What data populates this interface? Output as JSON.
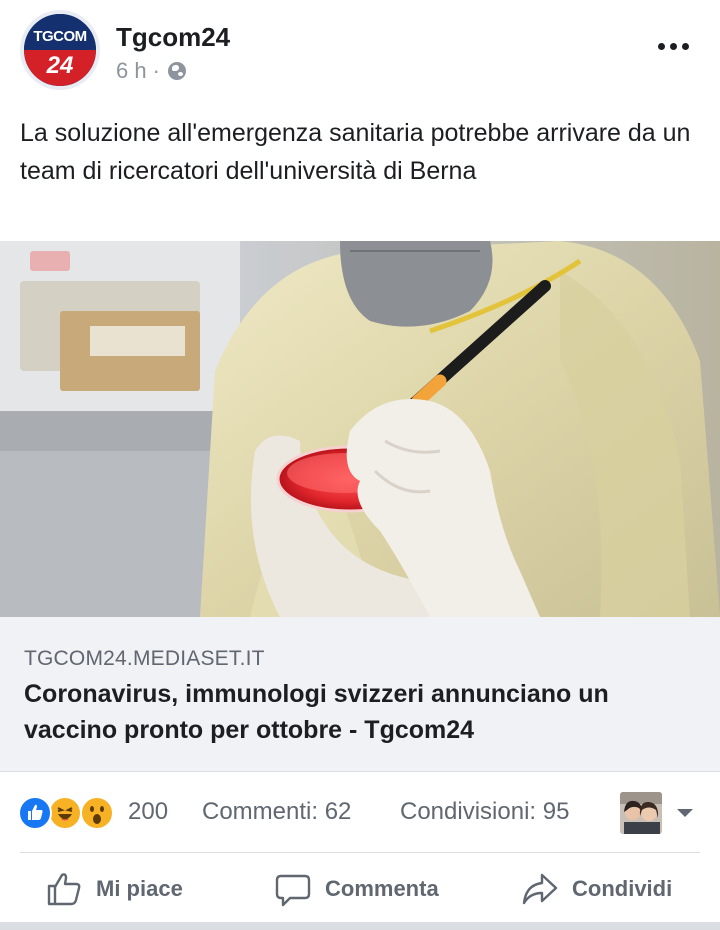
{
  "header": {
    "page_name": "Tgcom24",
    "time": "6 h",
    "separator": "·",
    "avatar_logo_top": "TGCOM",
    "avatar_logo_number": "24",
    "privacy_icon": "globe-icon",
    "more_icon": "more-options-icon"
  },
  "post": {
    "text": "La soluzione all'emergenza sanitaria potrebbe arrivare da un team di ricercatori dell'università di Berna"
  },
  "link_preview": {
    "domain": "TGCOM24.MEDIASET.IT",
    "title": "Coronavirus, immunologi svizzeri annunciano un vaccino pronto per ottobre - Tgcom24"
  },
  "reactions": {
    "icons": [
      "like-reaction-icon",
      "haha-reaction-icon",
      "wow-reaction-icon"
    ],
    "count": "200",
    "comments": "Commenti: 62",
    "shares": "Condivisioni: 95"
  },
  "actions": {
    "like_label": "Mi piace",
    "comment_label": "Commenta",
    "share_label": "Condividi"
  },
  "colors": {
    "accent": "#1877f2",
    "text": "#1c1e21",
    "muted": "#606770",
    "link_bg": "#f0f2f5",
    "brand_blue": "#14306e",
    "brand_red": "#d42027"
  }
}
